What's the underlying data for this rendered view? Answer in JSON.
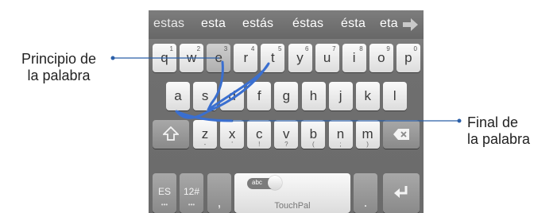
{
  "suggestions": [
    "estas",
    "esta",
    "estás",
    "éstas",
    "ésta",
    "eta"
  ],
  "keyboard": {
    "row1": [
      {
        "label": "q",
        "hint": "1"
      },
      {
        "label": "w",
        "hint": "2"
      },
      {
        "label": "e",
        "hint": "3"
      },
      {
        "label": "r",
        "hint": "4"
      },
      {
        "label": "t",
        "hint": "5"
      },
      {
        "label": "y",
        "hint": "6"
      },
      {
        "label": "u",
        "hint": "7"
      },
      {
        "label": "i",
        "hint": "8"
      },
      {
        "label": "o",
        "hint": "9"
      },
      {
        "label": "p",
        "hint": "0"
      }
    ],
    "row2": [
      "a",
      "s",
      "d",
      "f",
      "g",
      "h",
      "j",
      "k",
      "l"
    ],
    "row3": [
      {
        "label": "z",
        "sub": "-"
      },
      {
        "label": "x",
        "sub": "'"
      },
      {
        "label": "c",
        "sub": "!"
      },
      {
        "label": "v",
        "sub": "?"
      },
      {
        "label": "b",
        "sub": "("
      },
      {
        "label": "n",
        "sub": ";"
      },
      {
        "label": "m",
        "sub": ")"
      }
    ],
    "lang_label": "ES",
    "lang_dots": "•••",
    "num_label": "12#",
    "num_dots": "•••",
    "comma": ",",
    "period": ".",
    "space_toggle": "abc",
    "space_label": "TouchPal"
  },
  "callouts": {
    "start_line1": "Principio de",
    "start_line2": "la palabra",
    "end_line1": "Final de",
    "end_line2": "la palabra"
  },
  "colors": {
    "gesture_trail": "#3a6fd0",
    "callout_line": "#2b5fa8"
  }
}
